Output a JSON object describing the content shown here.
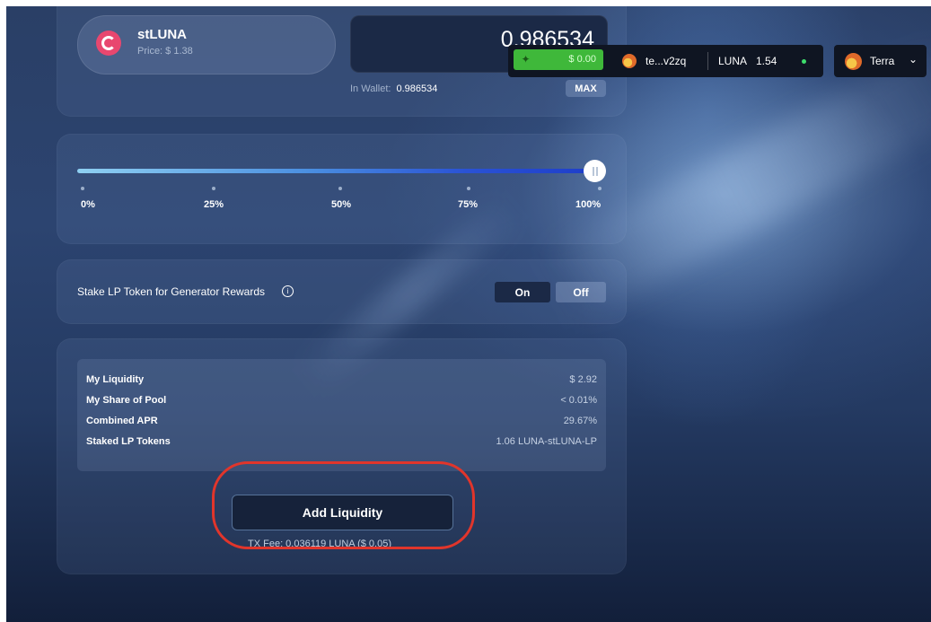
{
  "token": {
    "name": "stLUNA",
    "price": "Price: $ 1.38",
    "amount": "0.986534",
    "wallet_label": "In Wallet:",
    "wallet_value": "0.986534",
    "max_label": "MAX"
  },
  "wallet_bar": {
    "balance": "$ 0.00",
    "address": "te...v2zq",
    "luna_label": "LUNA",
    "luna_balance": "1.54"
  },
  "network": {
    "label": "Terra"
  },
  "slider": {
    "value_percent": 100,
    "ticks": [
      "0%",
      "25%",
      "50%",
      "75%",
      "100%"
    ]
  },
  "stake": {
    "label": "Stake LP Token for Generator Rewards",
    "on_label": "On",
    "off_label": "Off",
    "selected": "On"
  },
  "summary": {
    "rows": [
      {
        "label": "My Liquidity",
        "value": "$ 2.92"
      },
      {
        "label": "My Share of Pool",
        "value": "< 0.01%"
      },
      {
        "label": "Combined APR",
        "value": "29.67%"
      },
      {
        "label": "Staked LP Tokens",
        "value": "1.06 LUNA-stLUNA-LP"
      }
    ]
  },
  "action": {
    "button_label": "Add Liquidity",
    "tx_fee": "TX Fee: 0.036119 LUNA ($ 0.05)"
  },
  "colors": {
    "highlight": "#e1352b",
    "balance_green": "#3fb83a",
    "token_logo": "#e8476f"
  }
}
